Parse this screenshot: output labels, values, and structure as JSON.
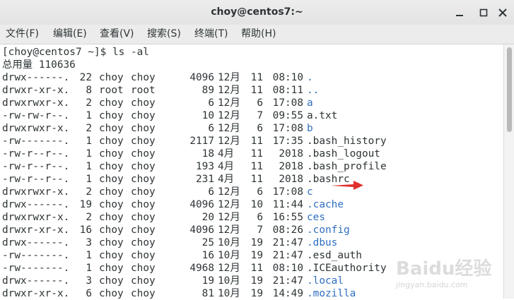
{
  "window": {
    "title": "choy@centos7:~"
  },
  "menu": [
    "文件(F)",
    "编辑(E)",
    "查看(V)",
    "搜索(S)",
    "终端(T)",
    "帮助(H)"
  ],
  "terminal": {
    "prompt": "[choy@centos7 ~]$ ls -al",
    "total": "总用量 110636",
    "rows": [
      {
        "perms": "drwx------.",
        "links": "22",
        "owner": "choy",
        "group": "choy",
        "size": "4096",
        "month": "12月",
        "day": "11",
        "time": "08:10",
        "name": ".",
        "dir": true
      },
      {
        "perms": "drwxr-xr-x.",
        "links": "8",
        "owner": "root",
        "group": "root",
        "size": "89",
        "month": "12月",
        "day": "11",
        "time": "08:11",
        "name": "..",
        "dir": true
      },
      {
        "perms": "drwxrwxr-x.",
        "links": "2",
        "owner": "choy",
        "group": "choy",
        "size": "6",
        "month": "12月",
        "day": "6",
        "time": "17:08",
        "name": "a",
        "dir": true
      },
      {
        "perms": "-rw-rw-r--.",
        "links": "1",
        "owner": "choy",
        "group": "choy",
        "size": "10",
        "month": "12月",
        "day": "7",
        "time": "09:55",
        "name": "a.txt",
        "dir": false
      },
      {
        "perms": "drwxrwxr-x.",
        "links": "2",
        "owner": "choy",
        "group": "choy",
        "size": "6",
        "month": "12月",
        "day": "6",
        "time": "17:08",
        "name": "b",
        "dir": true
      },
      {
        "perms": "-rw-------.",
        "links": "1",
        "owner": "choy",
        "group": "choy",
        "size": "2117",
        "month": "12月",
        "day": "11",
        "time": "17:35",
        "name": ".bash_history",
        "dir": false
      },
      {
        "perms": "-rw-r--r--.",
        "links": "1",
        "owner": "choy",
        "group": "choy",
        "size": "18",
        "month": "4月",
        "day": "11",
        "time": "2018",
        "name": ".bash_logout",
        "dir": false
      },
      {
        "perms": "-rw-r--r--.",
        "links": "1",
        "owner": "choy",
        "group": "choy",
        "size": "193",
        "month": "4月",
        "day": "11",
        "time": "2018",
        "name": ".bash_profile",
        "dir": false
      },
      {
        "perms": "-rw-r--r--.",
        "links": "1",
        "owner": "choy",
        "group": "choy",
        "size": "231",
        "month": "4月",
        "day": "11",
        "time": "2018",
        "name": ".bashrc",
        "dir": false
      },
      {
        "perms": "drwxrwxr-x.",
        "links": "2",
        "owner": "choy",
        "group": "choy",
        "size": "6",
        "month": "12月",
        "day": "6",
        "time": "17:08",
        "name": "c",
        "dir": true
      },
      {
        "perms": "drwx------.",
        "links": "19",
        "owner": "choy",
        "group": "choy",
        "size": "4096",
        "month": "12月",
        "day": "10",
        "time": "11:44",
        "name": ".cache",
        "dir": true
      },
      {
        "perms": "drwxrwxr-x.",
        "links": "2",
        "owner": "choy",
        "group": "choy",
        "size": "20",
        "month": "12月",
        "day": "6",
        "time": "16:55",
        "name": "ces",
        "dir": true
      },
      {
        "perms": "drwxr-xr-x.",
        "links": "16",
        "owner": "choy",
        "group": "choy",
        "size": "4096",
        "month": "12月",
        "day": "7",
        "time": "08:26",
        "name": ".config",
        "dir": true
      },
      {
        "perms": "drwx------.",
        "links": "3",
        "owner": "choy",
        "group": "choy",
        "size": "25",
        "month": "10月",
        "day": "19",
        "time": "21:47",
        "name": ".dbus",
        "dir": true
      },
      {
        "perms": "-rw-------.",
        "links": "1",
        "owner": "choy",
        "group": "choy",
        "size": "16",
        "month": "10月",
        "day": "19",
        "time": "21:47",
        "name": ".esd_auth",
        "dir": false
      },
      {
        "perms": "-rw-------.",
        "links": "1",
        "owner": "choy",
        "group": "choy",
        "size": "4968",
        "month": "12月",
        "day": "11",
        "time": "08:10",
        "name": ".ICEauthority",
        "dir": false
      },
      {
        "perms": "drwx------.",
        "links": "3",
        "owner": "choy",
        "group": "choy",
        "size": "19",
        "month": "10月",
        "day": "19",
        "time": "21:47",
        "name": ".local",
        "dir": true
      },
      {
        "perms": "drwxr-xr-x.",
        "links": "6",
        "owner": "choy",
        "group": "choy",
        "size": "81",
        "month": "10月",
        "day": "19",
        "time": "14:49",
        "name": ".mozilla",
        "dir": true
      }
    ]
  },
  "watermark": {
    "text": "Baidu经验",
    "sub": "jingyan.baidu.com"
  },
  "colors": {
    "dir": "#2f6fc1",
    "text": "#2e3436",
    "arrow": "#e03030"
  }
}
